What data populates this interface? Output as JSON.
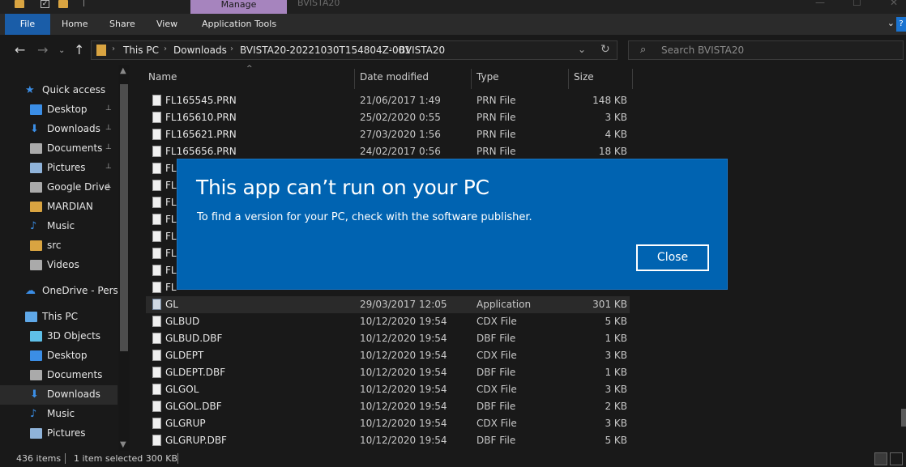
{
  "window": {
    "title": "BVISTA20",
    "manage_tab": "Manage",
    "controls": [
      "—",
      "☐",
      "✕"
    ]
  },
  "ribbon": {
    "tabs": [
      "File",
      "Home",
      "Share",
      "View",
      "Application Tools"
    ]
  },
  "address": {
    "crumbs": [
      "This PC",
      "Downloads",
      "BVISTA20-20221030T154804Z-001",
      "BVISTA20"
    ]
  },
  "search": {
    "placeholder": "Search BVISTA20"
  },
  "nav": {
    "items": [
      {
        "label": "Quick access",
        "icon": "star-icon",
        "color": "#3b8ee6",
        "pinned": false,
        "indent": 1
      },
      {
        "label": "Desktop",
        "icon": "desktop-icon",
        "color": "#3b8ee6",
        "pinned": true,
        "indent": 2
      },
      {
        "label": "Downloads",
        "icon": "download-icon",
        "color": "#3b8ee6",
        "pinned": true,
        "indent": 2
      },
      {
        "label": "Documents",
        "icon": "documents-icon",
        "color": "#aaaaaa",
        "pinned": true,
        "indent": 2
      },
      {
        "label": "Pictures",
        "icon": "pictures-icon",
        "color": "#8fb3d9",
        "pinned": true,
        "indent": 2
      },
      {
        "label": "Google Drive",
        "icon": "drive-icon",
        "color": "#aaaaaa",
        "pinned": true,
        "indent": 2
      },
      {
        "label": "MARDIAN",
        "icon": "folder-icon",
        "color": "#d9a441",
        "pinned": false,
        "indent": 2
      },
      {
        "label": "Music",
        "icon": "music-icon",
        "color": "#3b8ee6",
        "pinned": false,
        "indent": 2
      },
      {
        "label": "src",
        "icon": "folder-icon",
        "color": "#d9a441",
        "pinned": false,
        "indent": 2
      },
      {
        "label": "Videos",
        "icon": "videos-icon",
        "color": "#aaaaaa",
        "pinned": false,
        "indent": 2
      },
      {
        "label": "OneDrive - Person",
        "icon": "cloud-icon",
        "color": "#3b8ee6",
        "pinned": false,
        "indent": 1
      },
      {
        "label": "This PC",
        "icon": "pc-icon",
        "color": "#5fa8e8",
        "pinned": false,
        "indent": 1
      },
      {
        "label": "3D Objects",
        "icon": "cube-icon",
        "color": "#5fc0e8",
        "pinned": false,
        "indent": 2
      },
      {
        "label": "Desktop",
        "icon": "desktop-icon",
        "color": "#3b8ee6",
        "pinned": false,
        "indent": 2
      },
      {
        "label": "Documents",
        "icon": "documents-icon",
        "color": "#aaaaaa",
        "pinned": false,
        "indent": 2
      },
      {
        "label": "Downloads",
        "icon": "download-icon",
        "color": "#3b8ee6",
        "pinned": false,
        "indent": 2,
        "selected": true
      },
      {
        "label": "Music",
        "icon": "music-icon",
        "color": "#3b8ee6",
        "pinned": false,
        "indent": 2
      },
      {
        "label": "Pictures",
        "icon": "pictures-icon",
        "color": "#8fb3d9",
        "pinned": false,
        "indent": 2
      }
    ]
  },
  "columns": {
    "name": "Name",
    "date": "Date modified",
    "type": "Type",
    "size": "Size"
  },
  "files": [
    {
      "name": "FL165545.PRN",
      "date": "21/06/2017 1:49",
      "type": "PRN File",
      "size": "148 KB"
    },
    {
      "name": "FL165610.PRN",
      "date": "25/02/2020 0:55",
      "type": "PRN File",
      "size": "3 KB"
    },
    {
      "name": "FL165621.PRN",
      "date": "27/03/2020 1:56",
      "type": "PRN File",
      "size": "4 KB"
    },
    {
      "name": "FL165656.PRN",
      "date": "24/02/2017 0:56",
      "type": "PRN File",
      "size": "18 KB"
    },
    {
      "name": "FL",
      "date": "",
      "type": "",
      "size": ""
    },
    {
      "name": "FL",
      "date": "",
      "type": "",
      "size": ""
    },
    {
      "name": "FL",
      "date": "",
      "type": "",
      "size": ""
    },
    {
      "name": "FL",
      "date": "",
      "type": "",
      "size": ""
    },
    {
      "name": "FL",
      "date": "",
      "type": "",
      "size": ""
    },
    {
      "name": "FL",
      "date": "",
      "type": "",
      "size": ""
    },
    {
      "name": "FL",
      "date": "",
      "type": "",
      "size": ""
    },
    {
      "name": "FL",
      "date": "",
      "type": "",
      "size": ""
    },
    {
      "name": "GL",
      "date": "29/03/2017 12:05",
      "type": "Application",
      "size": "301 KB",
      "selected": true,
      "app": true
    },
    {
      "name": "GLBUD",
      "date": "10/12/2020 19:54",
      "type": "CDX File",
      "size": "5 KB"
    },
    {
      "name": "GLBUD.DBF",
      "date": "10/12/2020 19:54",
      "type": "DBF File",
      "size": "1 KB"
    },
    {
      "name": "GLDEPT",
      "date": "10/12/2020 19:54",
      "type": "CDX File",
      "size": "3 KB"
    },
    {
      "name": "GLDEPT.DBF",
      "date": "10/12/2020 19:54",
      "type": "DBF File",
      "size": "1 KB"
    },
    {
      "name": "GLGOL",
      "date": "10/12/2020 19:54",
      "type": "CDX File",
      "size": "3 KB"
    },
    {
      "name": "GLGOL.DBF",
      "date": "10/12/2020 19:54",
      "type": "DBF File",
      "size": "2 KB"
    },
    {
      "name": "GLGRUP",
      "date": "10/12/2020 19:54",
      "type": "CDX File",
      "size": "3 KB"
    },
    {
      "name": "GLGRUP.DBF",
      "date": "10/12/2020 19:54",
      "type": "DBF File",
      "size": "5 KB"
    }
  ],
  "dialog": {
    "title": "This app can’t run on your PC",
    "message": "To find a version for your PC, check with the software publisher.",
    "close_label": "Close"
  },
  "status": {
    "item_count": "436 items",
    "selection": "1 item selected  300 KB"
  },
  "colors": {
    "dialog_bg": "#0063b1",
    "file_tab": "#1a5da8",
    "manage_tab": "#a684be"
  }
}
